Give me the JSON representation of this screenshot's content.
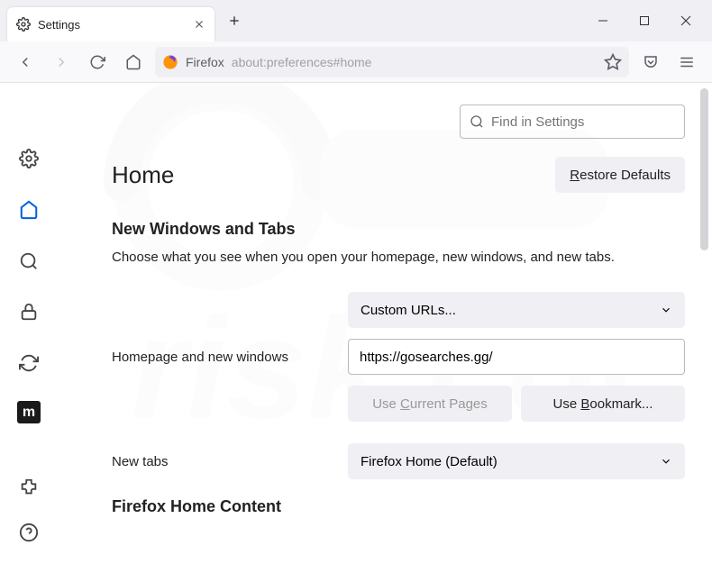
{
  "tab": {
    "title": "Settings"
  },
  "urlbar": {
    "label": "Firefox",
    "url": "about:preferences#home"
  },
  "search": {
    "placeholder": "Find in Settings"
  },
  "page": {
    "title": "Home",
    "restore_defaults": "Restore Defaults",
    "section1": {
      "heading": "New Windows and Tabs",
      "desc": "Choose what you see when you open your homepage, new windows, and new tabs.",
      "homepage_label": "Homepage and new windows",
      "homepage_select": "Custom URLs...",
      "homepage_value": "https://gosearches.gg/",
      "use_current": "Use Current Pages",
      "use_bookmark": "Use Bookmark...",
      "newtabs_label": "New tabs",
      "newtabs_select": "Firefox Home (Default)"
    },
    "section2": {
      "heading": "Firefox Home Content"
    }
  }
}
